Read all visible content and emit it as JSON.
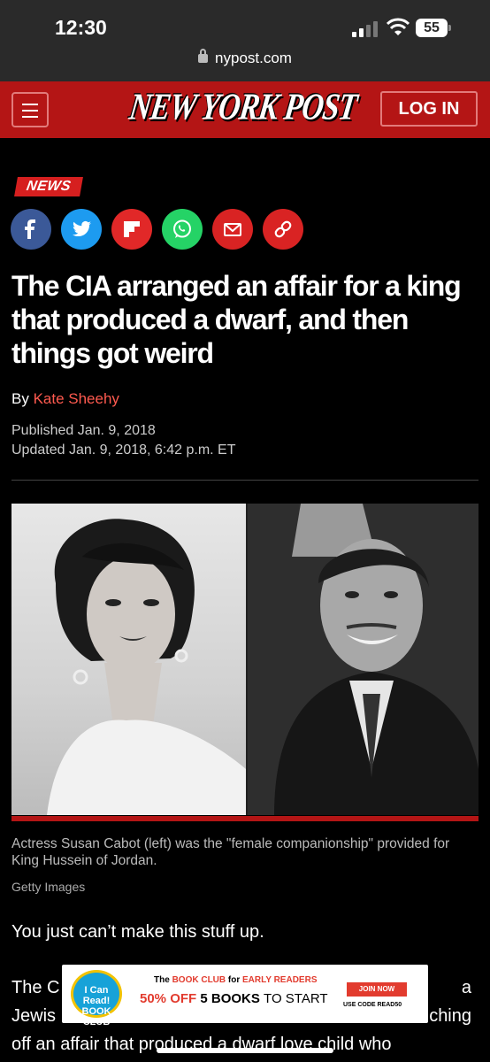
{
  "status_bar": {
    "time": "12:30",
    "battery": "55",
    "url": "nypost.com"
  },
  "header": {
    "logo": "NEW YORK POST",
    "login_label": "LOG IN"
  },
  "article": {
    "section_tag": "NEWS",
    "share_icons": [
      "facebook-icon",
      "twitter-icon",
      "flipboard-icon",
      "whatsapp-icon",
      "email-icon",
      "link-icon"
    ],
    "headline": "The CIA arranged an affair for a king that produced a dwarf, and then things got weird",
    "byline_prefix": "By ",
    "author": "Kate Sheehy",
    "published": "Published Jan. 9, 2018",
    "updated": "Updated Jan. 9, 2018, 6:42 p.m. ET",
    "caption": "Actress Susan Cabot (left) was the \"female companionship\" provided for King Hussein of Jordan.",
    "credit": "Getty Images",
    "lead": "You just can’t make this stuff up.",
    "body_line1": "The C",
    "body_line1_end": "a",
    "body_line2": "Jewis",
    "body_line2_end": "ching",
    "body_line3": "off an affair that produced a dwarf love child who"
  },
  "ad": {
    "badge": "I Can Read! BOOK CLUB",
    "line1_a": "The ",
    "line1_b": "BOOK CLUB",
    "line1_c": " for ",
    "line1_d": "EARLY READERS",
    "line2_a": "50% OFF",
    "line2_b": " 5 BOOKS ",
    "line2_c": "TO START",
    "join": "JOIN NOW",
    "code": "USE CODE READ50"
  },
  "colors": {
    "brand_red": "#b41515",
    "accent_red": "#ff5a4f"
  }
}
